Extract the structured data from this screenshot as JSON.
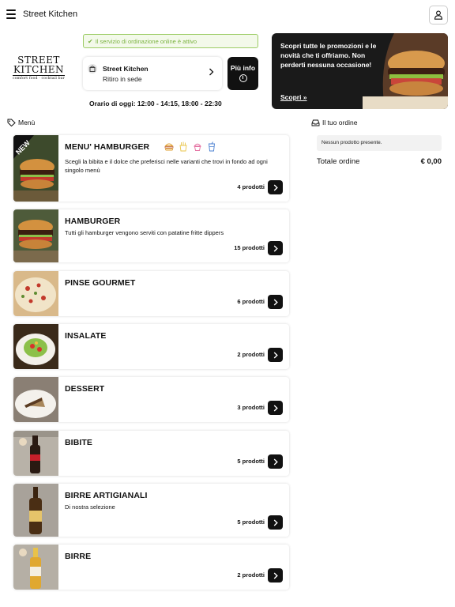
{
  "header": {
    "title": "Street Kitchen",
    "menu_icon": "hamburger-menu-icon",
    "user_icon": "user-icon"
  },
  "logo": {
    "line1": "STREET",
    "line2": "KITCHEN",
    "tagline": "comfort food · cocktail bar"
  },
  "status": {
    "text": "Il servizio di ordinazione online è attivo",
    "color": "#7cb342"
  },
  "store": {
    "name": "Street Kitchen",
    "mode": "Ritiro in sede"
  },
  "info_button": {
    "label": "Più info"
  },
  "hours": {
    "text": "Orario di oggi: 12:00 - 14:15, 18:00 - 22:30"
  },
  "promo": {
    "text": "Scopri tutte le promozioni e le novità che ti offriamo. Non perderti nessuna occasione!",
    "link": "Scopri »"
  },
  "menu_section": {
    "title": "Menù"
  },
  "order_section": {
    "title": "Il tuo ordine",
    "empty_text": "Nessun prodotto presente.",
    "total_label": "Totale ordine",
    "total_value": "€ 0,00"
  },
  "categories": [
    {
      "title": "MENU' HAMBURGER",
      "desc": "Scegli la bibita e il dolce che preferisci nelle varianti che trovi in fondo ad ogni singolo menù",
      "count": "4 prodotti",
      "badge": "NEW"
    },
    {
      "title": "HAMBURGER",
      "desc": "Tutti gli hamburger vengono serviti con patatine fritte dippers",
      "count": "15 prodotti"
    },
    {
      "title": "PINSE GOURMET",
      "desc": "",
      "count": "6 prodotti"
    },
    {
      "title": "INSALATE",
      "desc": "",
      "count": "2 prodotti"
    },
    {
      "title": "DESSERT",
      "desc": "",
      "count": "3 prodotti"
    },
    {
      "title": "BIBITE",
      "desc": "",
      "count": "5 prodotti"
    },
    {
      "title": "BIRRE ARTIGIANALI",
      "desc": "Di nostra selezione",
      "count": "5 prodotti"
    },
    {
      "title": "BIRRE",
      "desc": "",
      "count": "2 prodotti"
    }
  ],
  "colors": {
    "accent": "#111111",
    "status_green": "#9ccc65"
  }
}
